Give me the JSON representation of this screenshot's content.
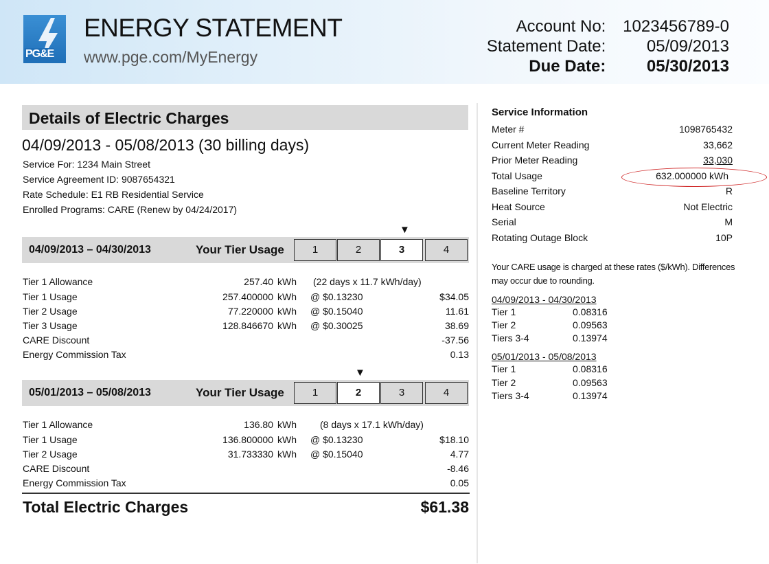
{
  "header": {
    "logo_text": "PG&E",
    "title": "ENERGY STATEMENT",
    "url": "www.pge.com/MyEnergy",
    "account_label": "Account No:",
    "account_value": "1023456789-0",
    "statement_date_label": "Statement Date:",
    "statement_date_value": "05/09/2013",
    "due_date_label": "Due Date:",
    "due_date_value": "05/30/2013"
  },
  "details": {
    "title": "Details of Electric Charges",
    "period": "04/09/2013 - 05/08/2013 (30 billing days)",
    "service_for": "Service For: 1234 Main Street",
    "agreement": "Service Agreement ID: 9087654321",
    "rate_schedule": "Rate Schedule:  E1 RB Residential Service",
    "programs": "Enrolled Programs:  CARE (Renew by 04/24/2017)"
  },
  "tier_usage_label": "Your Tier Usage",
  "tier_numbers": [
    "1",
    "2",
    "3",
    "4"
  ],
  "marker_glyph": "▼",
  "periods": [
    {
      "range": "04/09/2013 – 04/30/2013",
      "active_tier": 3,
      "rows": [
        {
          "label": "Tier 1 Allowance",
          "qty": "257.40",
          "unit": "kWh",
          "rate": "(22 days x 11.7 kWh/day)",
          "amount": ""
        },
        {
          "label": "Tier 1 Usage",
          "qty": "257.400000",
          "unit": "kWh",
          "rate": "@ $0.13230",
          "amount": "$34.05"
        },
        {
          "label": "Tier 2 Usage",
          "qty": "77.220000",
          "unit": "kWh",
          "rate": "@ $0.15040",
          "amount": "11.61"
        },
        {
          "label": "Tier 3 Usage",
          "qty": "128.846670",
          "unit": "kWh",
          "rate": "@ $0.30025",
          "amount": "38.69"
        },
        {
          "label": "CARE Discount",
          "qty": "",
          "unit": "",
          "rate": "",
          "amount": "-37.56"
        },
        {
          "label": "Energy Commission Tax",
          "qty": "",
          "unit": "",
          "rate": "",
          "amount": "0.13"
        }
      ]
    },
    {
      "range": "05/01/2013 – 05/08/2013",
      "active_tier": 2,
      "rows": [
        {
          "label": "Tier 1 Allowance",
          "qty": "136.80",
          "unit": "kWh",
          "rate": "(8 days x 17.1 kWh/day)",
          "amount": ""
        },
        {
          "label": "Tier 1 Usage",
          "qty": "136.800000",
          "unit": "kWh",
          "rate": "@ $0.13230",
          "amount": "$18.10"
        },
        {
          "label": "Tier 2 Usage",
          "qty": "31.733330",
          "unit": "kWh",
          "rate": "@ $0.15040",
          "amount": "4.77"
        },
        {
          "label": "CARE Discount",
          "qty": "",
          "unit": "",
          "rate": "",
          "amount": "-8.46"
        },
        {
          "label": "Energy Commission Tax",
          "qty": "",
          "unit": "",
          "rate": "",
          "amount": "0.05"
        }
      ]
    }
  ],
  "total": {
    "label": "Total Electric Charges",
    "amount": "$61.38"
  },
  "service_info": {
    "title": "Service Information",
    "rows": [
      {
        "label": "Meter #",
        "value": "1098765432"
      },
      {
        "label": "Current Meter Reading",
        "value": "33,662"
      },
      {
        "label": "Prior Meter Reading",
        "value": "33,030"
      },
      {
        "label": "Total Usage",
        "value": "632.000000 kWh"
      },
      {
        "label": "Baseline Territory",
        "value": "R"
      },
      {
        "label": "Heat Source",
        "value": "Not Electric"
      },
      {
        "label": "Serial",
        "value": "M"
      },
      {
        "label": "Rotating Outage Block",
        "value": "10P"
      }
    ],
    "highlight_color": "#d02b2b"
  },
  "care_note": "Your CARE usage is charged at these rates ($/kWh). Differences may occur due to rounding.",
  "care_rates": [
    {
      "range": "04/09/2013 - 04/30/2013",
      "rows": [
        {
          "tier": "Tier 1",
          "rate": "0.08316"
        },
        {
          "tier": "Tier 2",
          "rate": "0.09563"
        },
        {
          "tier": "Tiers 3-4",
          "rate": "0.13974"
        }
      ]
    },
    {
      "range": "05/01/2013 - 05/08/2013",
      "rows": [
        {
          "tier": "Tier 1",
          "rate": "0.08316"
        },
        {
          "tier": "Tier 2",
          "rate": "0.09563"
        },
        {
          "tier": "Tiers 3-4",
          "rate": "0.13974"
        }
      ]
    }
  ]
}
